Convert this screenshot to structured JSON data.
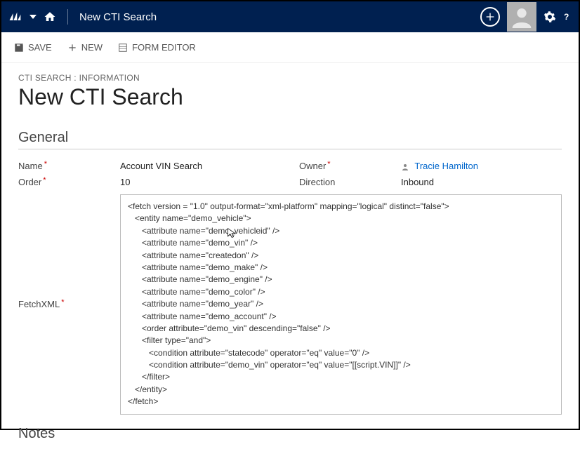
{
  "topbar": {
    "breadcrumb": "New CTI Search"
  },
  "toolbar": {
    "save": "SAVE",
    "new": "NEW",
    "form_editor": "FORM EDITOR"
  },
  "header": {
    "entity_line": "CTI SEARCH : INFORMATION",
    "title": "New CTI Search"
  },
  "sections": {
    "general": "General",
    "notes": "Notes"
  },
  "fields": {
    "name_label": "Name",
    "name_value": "Account VIN Search",
    "owner_label": "Owner",
    "owner_value": "Tracie Hamilton",
    "order_label": "Order",
    "order_value": "10",
    "direction_label": "Direction",
    "direction_value": "Inbound",
    "fetchxml_label": "FetchXML",
    "fetchxml_value": "<fetch version = \"1.0\" output-format=\"xml-platform\" mapping=\"logical\" distinct=\"false\">\n   <entity name=\"demo_vehicle\">\n      <attribute name=\"demo_vehicleid\" />\n      <attribute name=\"demo_vin\" />\n      <attribute name=\"createdon\" />\n      <attribute name=\"demo_make\" />\n      <attribute name=\"demo_engine\" />\n      <attribute name=\"demo_color\" />\n      <attribute name=\"demo_year\" />\n      <attribute name=\"demo_account\" />\n      <order attribute=\"demo_vin\" descending=\"false\" />\n      <filter type=\"and\">\n         <condition attribute=\"statecode\" operator=\"eq\" value=\"0\" />\n         <condition attribute=\"demo_vin\" operator=\"eq\" value=\"[[script.VIN]]\" />\n      </filter>\n   </entity>\n</fetch>"
  }
}
